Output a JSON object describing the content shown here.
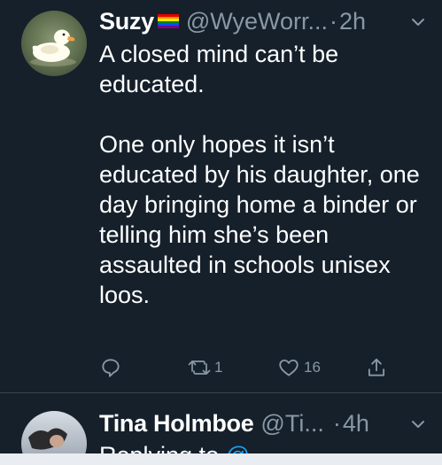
{
  "tweets": [
    {
      "display_name": "Suzy",
      "handle": "@WyeWorr...",
      "separator": "·",
      "time": "2h",
      "paragraphs": [
        "A closed mind can’t be educated.",
        "One only hopes it isn’t educated by his daughter, one day bringing home a binder or telling him she’s been assaulted in schools unisex loos."
      ],
      "actions": {
        "reply_icon": "reply-icon",
        "retweet_icon": "retweet-icon",
        "retweet_count": "1",
        "like_icon": "heart-icon",
        "like_count": "16",
        "share_icon": "share-icon"
      },
      "flag_colors": [
        "#e40303",
        "#ff8c00",
        "#ffed00",
        "#008026",
        "#004dff",
        "#750787"
      ]
    },
    {
      "display_name": "Tina Holmboe",
      "handle": "@Ti...",
      "separator": "·",
      "time": "4h",
      "peek_text": "Replying to",
      "peek_link": "@...",
      "cut_off": true
    }
  ],
  "colors": {
    "background": "#15202b",
    "text": "#ffffff",
    "muted": "#8899a6",
    "link": "#1da1f2",
    "divider": "#38444d"
  }
}
